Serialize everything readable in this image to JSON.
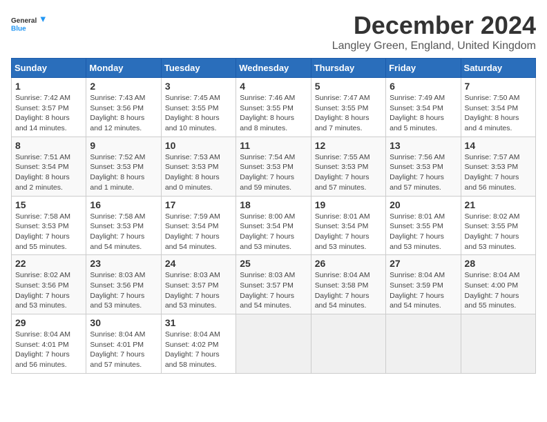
{
  "logo": {
    "line1": "General",
    "line2": "Blue"
  },
  "title": "December 2024",
  "subtitle": "Langley Green, England, United Kingdom",
  "days_header": [
    "Sunday",
    "Monday",
    "Tuesday",
    "Wednesday",
    "Thursday",
    "Friday",
    "Saturday"
  ],
  "weeks": [
    [
      {
        "day": "1",
        "sunrise": "Sunrise: 7:42 AM",
        "sunset": "Sunset: 3:57 PM",
        "daylight": "Daylight: 8 hours and 14 minutes."
      },
      {
        "day": "2",
        "sunrise": "Sunrise: 7:43 AM",
        "sunset": "Sunset: 3:56 PM",
        "daylight": "Daylight: 8 hours and 12 minutes."
      },
      {
        "day": "3",
        "sunrise": "Sunrise: 7:45 AM",
        "sunset": "Sunset: 3:55 PM",
        "daylight": "Daylight: 8 hours and 10 minutes."
      },
      {
        "day": "4",
        "sunrise": "Sunrise: 7:46 AM",
        "sunset": "Sunset: 3:55 PM",
        "daylight": "Daylight: 8 hours and 8 minutes."
      },
      {
        "day": "5",
        "sunrise": "Sunrise: 7:47 AM",
        "sunset": "Sunset: 3:55 PM",
        "daylight": "Daylight: 8 hours and 7 minutes."
      },
      {
        "day": "6",
        "sunrise": "Sunrise: 7:49 AM",
        "sunset": "Sunset: 3:54 PM",
        "daylight": "Daylight: 8 hours and 5 minutes."
      },
      {
        "day": "7",
        "sunrise": "Sunrise: 7:50 AM",
        "sunset": "Sunset: 3:54 PM",
        "daylight": "Daylight: 8 hours and 4 minutes."
      }
    ],
    [
      {
        "day": "8",
        "sunrise": "Sunrise: 7:51 AM",
        "sunset": "Sunset: 3:54 PM",
        "daylight": "Daylight: 8 hours and 2 minutes."
      },
      {
        "day": "9",
        "sunrise": "Sunrise: 7:52 AM",
        "sunset": "Sunset: 3:53 PM",
        "daylight": "Daylight: 8 hours and 1 minute."
      },
      {
        "day": "10",
        "sunrise": "Sunrise: 7:53 AM",
        "sunset": "Sunset: 3:53 PM",
        "daylight": "Daylight: 8 hours and 0 minutes."
      },
      {
        "day": "11",
        "sunrise": "Sunrise: 7:54 AM",
        "sunset": "Sunset: 3:53 PM",
        "daylight": "Daylight: 7 hours and 59 minutes."
      },
      {
        "day": "12",
        "sunrise": "Sunrise: 7:55 AM",
        "sunset": "Sunset: 3:53 PM",
        "daylight": "Daylight: 7 hours and 57 minutes."
      },
      {
        "day": "13",
        "sunrise": "Sunrise: 7:56 AM",
        "sunset": "Sunset: 3:53 PM",
        "daylight": "Daylight: 7 hours and 57 minutes."
      },
      {
        "day": "14",
        "sunrise": "Sunrise: 7:57 AM",
        "sunset": "Sunset: 3:53 PM",
        "daylight": "Daylight: 7 hours and 56 minutes."
      }
    ],
    [
      {
        "day": "15",
        "sunrise": "Sunrise: 7:58 AM",
        "sunset": "Sunset: 3:53 PM",
        "daylight": "Daylight: 7 hours and 55 minutes."
      },
      {
        "day": "16",
        "sunrise": "Sunrise: 7:58 AM",
        "sunset": "Sunset: 3:53 PM",
        "daylight": "Daylight: 7 hours and 54 minutes."
      },
      {
        "day": "17",
        "sunrise": "Sunrise: 7:59 AM",
        "sunset": "Sunset: 3:54 PM",
        "daylight": "Daylight: 7 hours and 54 minutes."
      },
      {
        "day": "18",
        "sunrise": "Sunrise: 8:00 AM",
        "sunset": "Sunset: 3:54 PM",
        "daylight": "Daylight: 7 hours and 53 minutes."
      },
      {
        "day": "19",
        "sunrise": "Sunrise: 8:01 AM",
        "sunset": "Sunset: 3:54 PM",
        "daylight": "Daylight: 7 hours and 53 minutes."
      },
      {
        "day": "20",
        "sunrise": "Sunrise: 8:01 AM",
        "sunset": "Sunset: 3:55 PM",
        "daylight": "Daylight: 7 hours and 53 minutes."
      },
      {
        "day": "21",
        "sunrise": "Sunrise: 8:02 AM",
        "sunset": "Sunset: 3:55 PM",
        "daylight": "Daylight: 7 hours and 53 minutes."
      }
    ],
    [
      {
        "day": "22",
        "sunrise": "Sunrise: 8:02 AM",
        "sunset": "Sunset: 3:56 PM",
        "daylight": "Daylight: 7 hours and 53 minutes."
      },
      {
        "day": "23",
        "sunrise": "Sunrise: 8:03 AM",
        "sunset": "Sunset: 3:56 PM",
        "daylight": "Daylight: 7 hours and 53 minutes."
      },
      {
        "day": "24",
        "sunrise": "Sunrise: 8:03 AM",
        "sunset": "Sunset: 3:57 PM",
        "daylight": "Daylight: 7 hours and 53 minutes."
      },
      {
        "day": "25",
        "sunrise": "Sunrise: 8:03 AM",
        "sunset": "Sunset: 3:57 PM",
        "daylight": "Daylight: 7 hours and 54 minutes."
      },
      {
        "day": "26",
        "sunrise": "Sunrise: 8:04 AM",
        "sunset": "Sunset: 3:58 PM",
        "daylight": "Daylight: 7 hours and 54 minutes."
      },
      {
        "day": "27",
        "sunrise": "Sunrise: 8:04 AM",
        "sunset": "Sunset: 3:59 PM",
        "daylight": "Daylight: 7 hours and 54 minutes."
      },
      {
        "day": "28",
        "sunrise": "Sunrise: 8:04 AM",
        "sunset": "Sunset: 4:00 PM",
        "daylight": "Daylight: 7 hours and 55 minutes."
      }
    ],
    [
      {
        "day": "29",
        "sunrise": "Sunrise: 8:04 AM",
        "sunset": "Sunset: 4:01 PM",
        "daylight": "Daylight: 7 hours and 56 minutes."
      },
      {
        "day": "30",
        "sunrise": "Sunrise: 8:04 AM",
        "sunset": "Sunset: 4:01 PM",
        "daylight": "Daylight: 7 hours and 57 minutes."
      },
      {
        "day": "31",
        "sunrise": "Sunrise: 8:04 AM",
        "sunset": "Sunset: 4:02 PM",
        "daylight": "Daylight: 7 hours and 58 minutes."
      },
      null,
      null,
      null,
      null
    ]
  ]
}
